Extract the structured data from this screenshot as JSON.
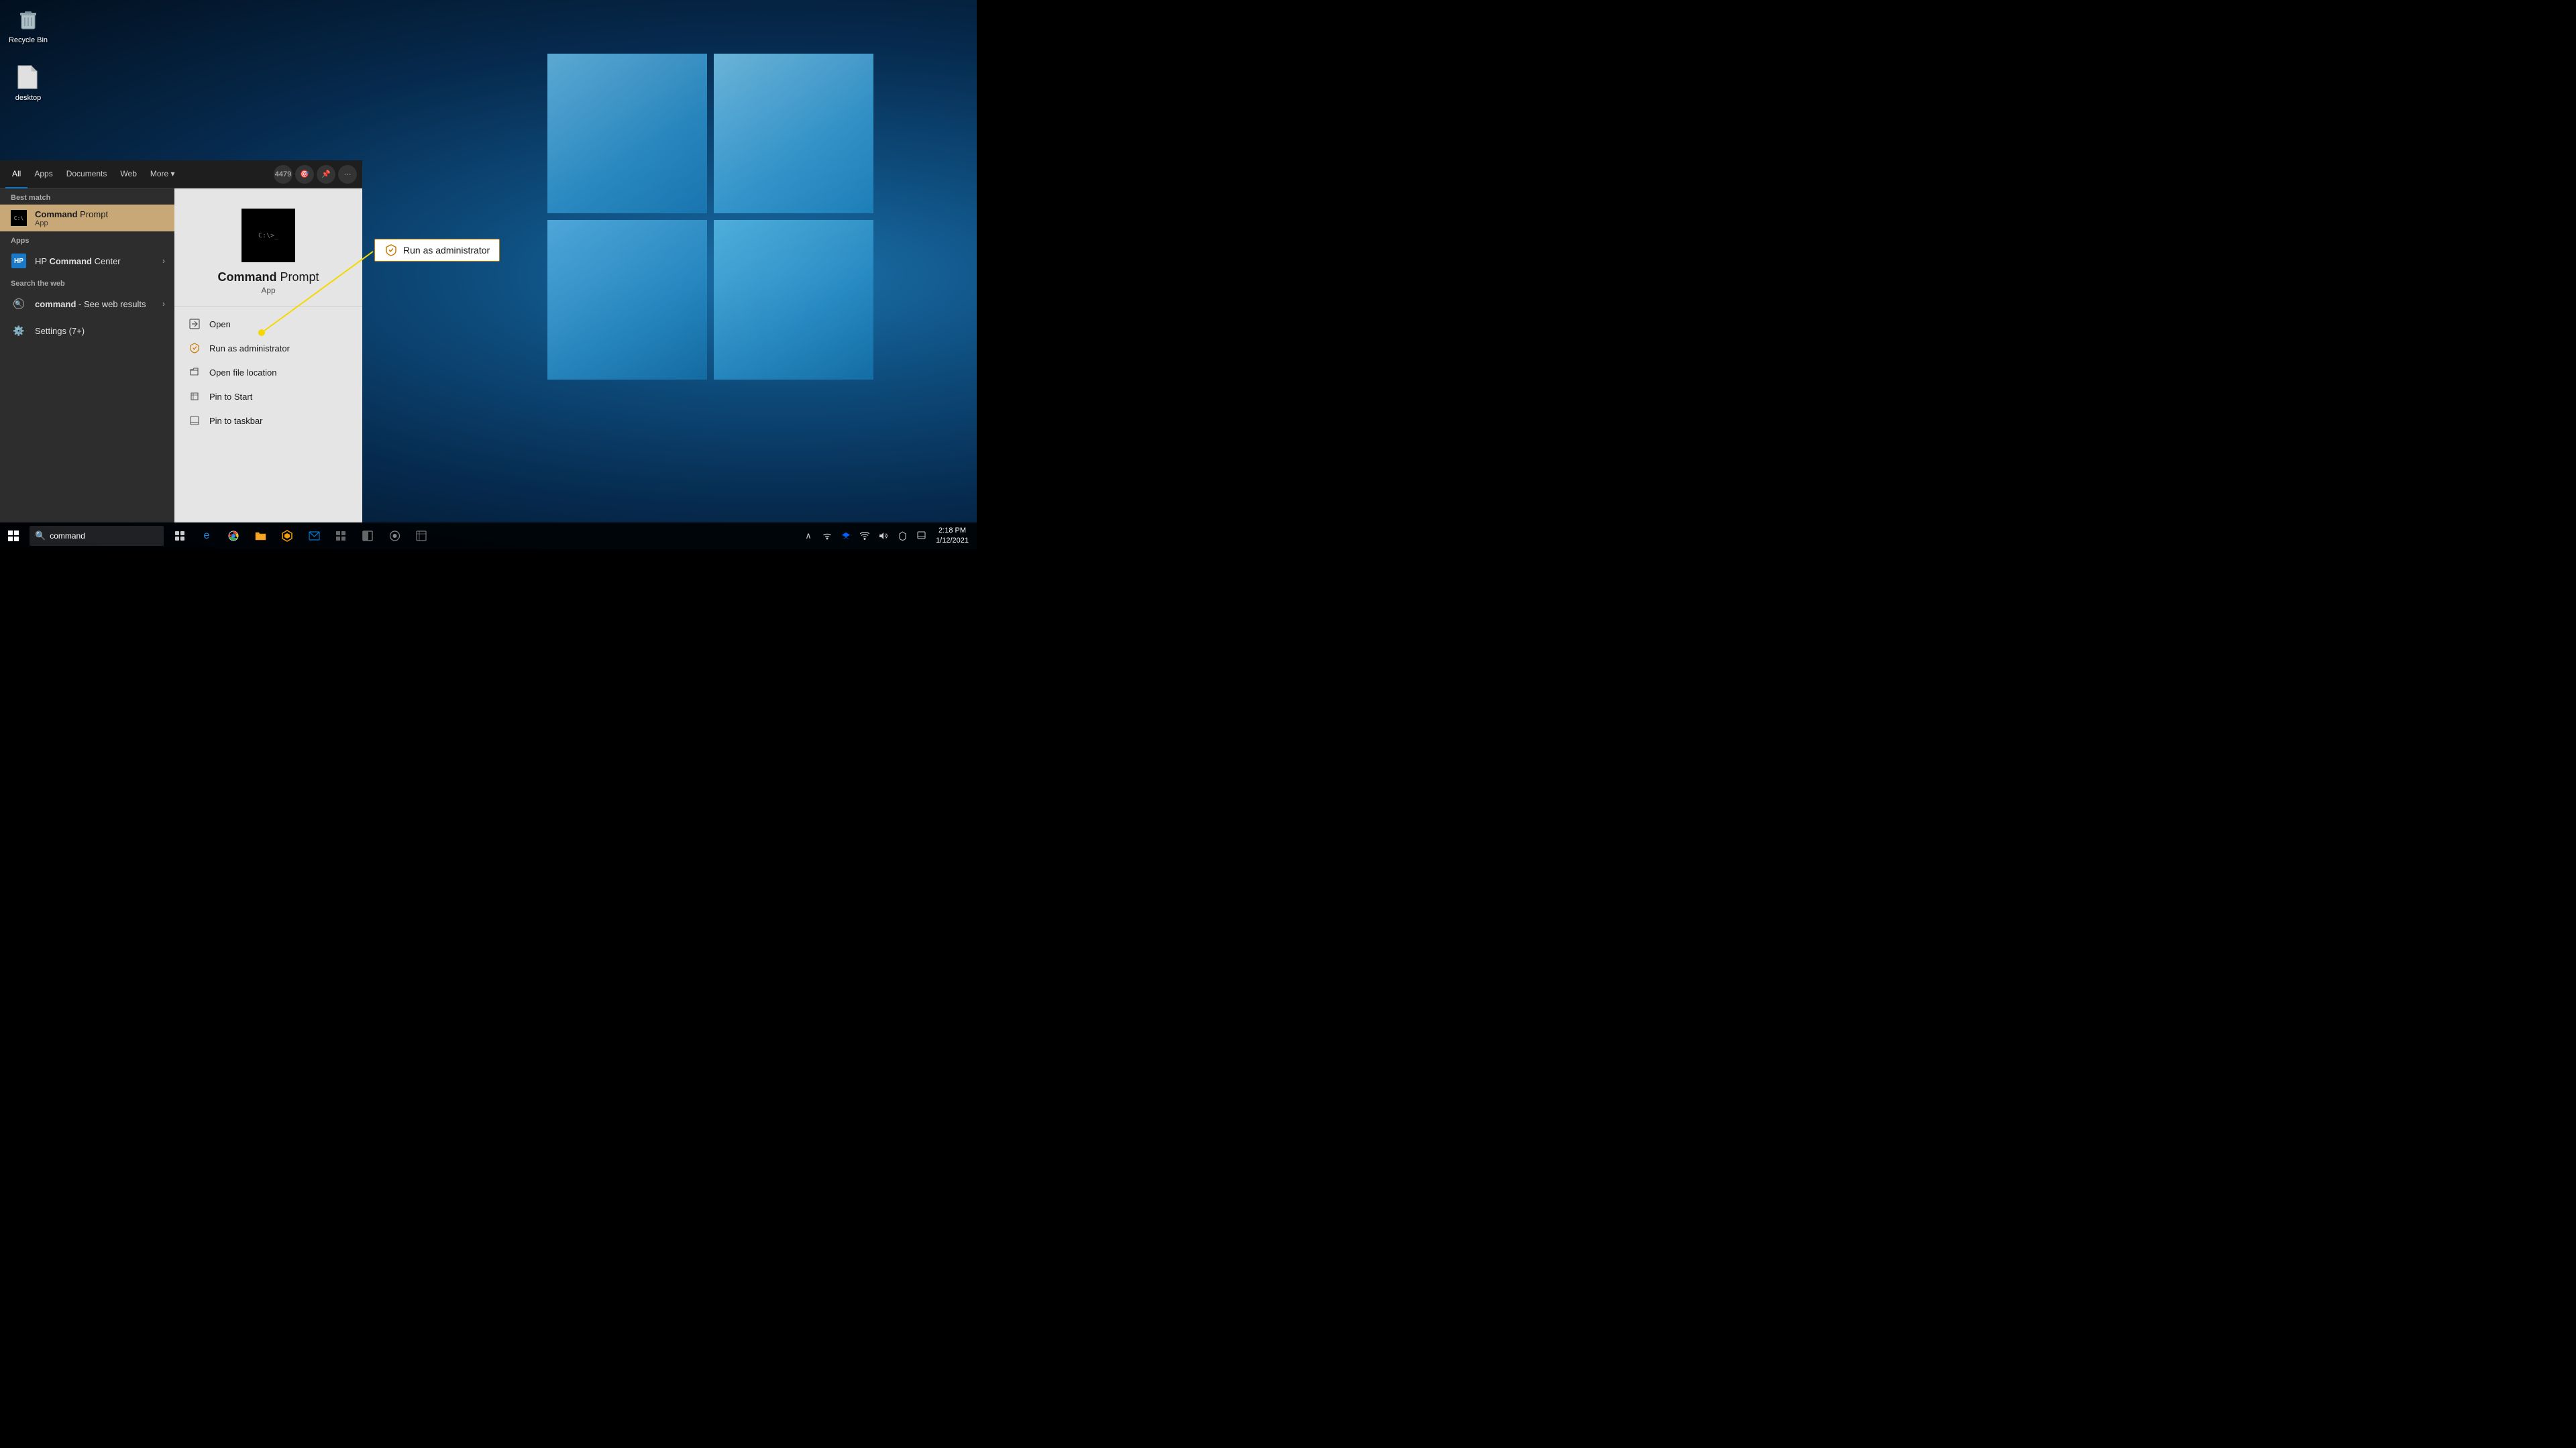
{
  "desktop": {
    "background": "Windows 10 blue desktop",
    "icons": [
      {
        "id": "recycle-bin",
        "label": "Recycle Bin",
        "icon": "🗑️"
      },
      {
        "id": "desktop-file",
        "label": "desktop",
        "icon": "📄"
      }
    ]
  },
  "taskbar": {
    "search_text": "command",
    "search_placeholder": "command",
    "clock": {
      "time": "2:18 PM",
      "date": "1/12/2021"
    },
    "apps": [
      {
        "id": "task-view",
        "icon": "⊞",
        "label": "Task View"
      },
      {
        "id": "edge",
        "icon": "⬡",
        "label": "Microsoft Edge"
      },
      {
        "id": "chrome",
        "icon": "●",
        "label": "Google Chrome"
      },
      {
        "id": "explorer",
        "icon": "📁",
        "label": "File Explorer"
      },
      {
        "id": "sublime",
        "icon": "♦",
        "label": "Sublime Text"
      },
      {
        "id": "mail",
        "icon": "✉",
        "label": "Mail"
      },
      {
        "id": "app1",
        "icon": "▦",
        "label": "App"
      },
      {
        "id": "app2",
        "icon": "◧",
        "label": "App"
      },
      {
        "id": "steam",
        "icon": "♟",
        "label": "Steam"
      },
      {
        "id": "app3",
        "icon": "🎴",
        "label": "App"
      }
    ],
    "system_icons": [
      {
        "id": "chevron",
        "icon": "∧",
        "label": "Show hidden icons"
      },
      {
        "id": "network",
        "icon": "🌐",
        "label": "Network"
      },
      {
        "id": "dropbox",
        "icon": "◈",
        "label": "Dropbox"
      },
      {
        "id": "wifi",
        "icon": "((·))",
        "label": "WiFi"
      },
      {
        "id": "volume",
        "icon": "🔊",
        "label": "Volume"
      },
      {
        "id": "tablet",
        "icon": "☐",
        "label": "Tablet mode"
      },
      {
        "id": "notification",
        "icon": "🗨",
        "label": "Notifications"
      }
    ]
  },
  "start_menu": {
    "tabs": [
      {
        "id": "all",
        "label": "All",
        "active": true
      },
      {
        "id": "apps",
        "label": "Apps",
        "active": false
      },
      {
        "id": "documents",
        "label": "Documents",
        "active": false
      },
      {
        "id": "web",
        "label": "Web",
        "active": false
      },
      {
        "id": "more",
        "label": "More ▾",
        "active": false
      }
    ],
    "badge": "4479",
    "sections": {
      "best_match": {
        "label": "Best match",
        "items": [
          {
            "id": "cmd-app",
            "title": "Command Prompt",
            "title_bold": "Command",
            "subtitle": "App",
            "highlighted": true
          }
        ]
      },
      "apps": {
        "label": "Apps",
        "items": [
          {
            "id": "hp-cmd",
            "title": "HP Command Center",
            "title_bold": "Command",
            "has_arrow": true
          }
        ]
      },
      "search_web": {
        "label": "Search the web",
        "items": [
          {
            "id": "web-search",
            "query": "command",
            "suffix": "- See web results",
            "has_arrow": true
          }
        ]
      },
      "settings": {
        "label": "Settings (7+)"
      }
    },
    "right_pane": {
      "app_name_prefix": "Command ",
      "app_name_bold": "Prompt",
      "app_type": "App",
      "context_items": [
        {
          "id": "open",
          "label": "Open",
          "icon": "⊡"
        },
        {
          "id": "run-admin",
          "label": "Run as administrator",
          "icon": "⊡"
        },
        {
          "id": "open-location",
          "label": "Open file location",
          "icon": "⊡"
        },
        {
          "id": "pin-start",
          "label": "Pin to Start",
          "icon": "⊡"
        },
        {
          "id": "pin-taskbar",
          "label": "Pin to taskbar",
          "icon": "⊡"
        }
      ]
    }
  },
  "tooltip": {
    "label": "Run as administrator",
    "icon": "shield"
  }
}
